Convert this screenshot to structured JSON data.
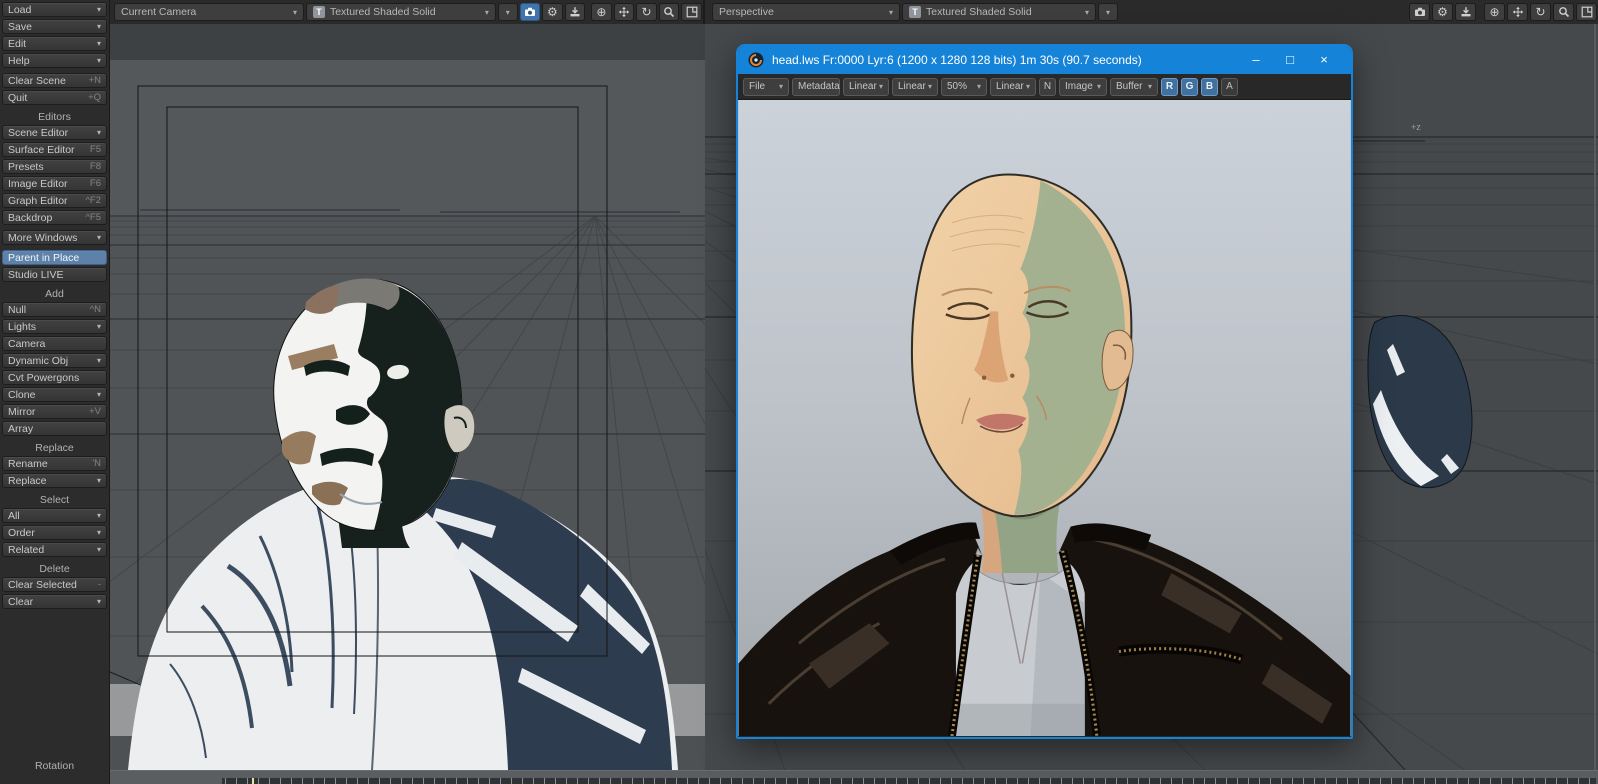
{
  "colors": {
    "accent_blue": "#1583d7",
    "selected_row": "#5d81a9",
    "channel_active": "#40719f"
  },
  "sidebar": {
    "menus": [
      "Load",
      "Save",
      "Edit",
      "Help"
    ],
    "actions": [
      {
        "label": "Clear Scene",
        "key": "+N"
      },
      {
        "label": "Quit",
        "key": "+Q"
      }
    ],
    "sections": [
      {
        "title": "Editors",
        "items": [
          {
            "label": "Scene Editor"
          },
          {
            "label": "Surface Editor",
            "key": "F5"
          },
          {
            "label": "Presets",
            "key": "F8"
          },
          {
            "label": "Image Editor",
            "key": "F6"
          },
          {
            "label": "Graph Editor",
            "key": "^F2"
          },
          {
            "label": "Backdrop",
            "key": "^F5"
          }
        ]
      },
      {
        "title": "Add",
        "items": [
          {
            "label": "Null",
            "key": "^N"
          },
          {
            "label": "Lights"
          },
          {
            "label": "Camera"
          },
          {
            "label": "Dynamic Obj"
          },
          {
            "label": "Cvt Powergons"
          },
          {
            "label": "Clone"
          },
          {
            "label": "Mirror",
            "key": "+V"
          },
          {
            "label": "Array"
          }
        ]
      },
      {
        "title": "Replace",
        "items": [
          {
            "label": "Rename",
            "key": "'N"
          },
          {
            "label": "Replace"
          }
        ]
      },
      {
        "title": "Select",
        "items": [
          {
            "label": "All"
          },
          {
            "label": "Order"
          },
          {
            "label": "Related"
          }
        ]
      },
      {
        "title": "Delete",
        "items": [
          {
            "label": "Clear Selected",
            "key": "-"
          },
          {
            "label": "Clear"
          }
        ]
      }
    ],
    "more_windows": "More Windows",
    "windows": [
      {
        "label": "Parent in Place",
        "selected": true
      },
      {
        "label": "Studio LIVE",
        "selected": false
      }
    ],
    "bottom_label": "Rotation"
  },
  "toolbar_left": {
    "camera": "Current Camera",
    "shading": "Textured Shaded Solid",
    "shading_badge": "T"
  },
  "toolbar_right": {
    "view": "Perspective",
    "shading": "Textured Shaded Solid",
    "shading_badge": "T"
  },
  "render_window": {
    "title": "head.lws Fr:0000 Lyr:6 (1200 x 1280 128 bits) 1m 30s (90.7 seconds)",
    "toolbar": {
      "file": "File",
      "metadata": "Metadata",
      "colorspace1": "Linear",
      "colorspace2": "Linear",
      "zoom": "50%",
      "colorspace3": "Linear",
      "n": "N",
      "image": "Image",
      "buffer": "Buffer",
      "channels": [
        "R",
        "G",
        "B",
        "A"
      ]
    }
  },
  "viewport_right": {
    "axis_label": "+z"
  },
  "icons": {
    "chevron_down": "▾",
    "minimize": "–",
    "maximize": "□",
    "close": "×",
    "gear": "⚙",
    "rotate_view": "↻",
    "center_view": "⊕"
  }
}
